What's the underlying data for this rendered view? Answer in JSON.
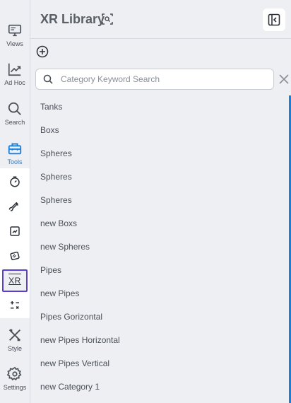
{
  "nav": {
    "items": [
      {
        "label": "Views",
        "icon": "monitor-icon"
      },
      {
        "label": "Ad Hoc",
        "icon": "chart-line-icon"
      },
      {
        "label": "Search",
        "icon": "search-icon"
      },
      {
        "label": "Tools",
        "icon": "toolbox-icon",
        "active": true
      },
      {
        "label": "Style",
        "icon": "pencil-ruler-icon"
      },
      {
        "label": "Settings",
        "icon": "gear-icon"
      }
    ],
    "tools": [
      {
        "icon": "gauge-icon"
      },
      {
        "icon": "paint-brush-icon"
      },
      {
        "icon": "chart-card-icon"
      },
      {
        "icon": "stack-icon"
      },
      {
        "icon": "xr-icon",
        "text": "XR",
        "selected": true
      },
      {
        "icon": "calculator-icon"
      }
    ]
  },
  "header": {
    "title": "XR Library"
  },
  "search": {
    "placeholder": "Category Keyword Search",
    "value": ""
  },
  "categories": [
    "Tanks",
    "Boxs",
    "Spheres",
    "Spheres",
    "Spheres",
    "new Boxs",
    "new Spheres",
    "Pipes",
    "new Pipes",
    "Pipes Gorizontal",
    "new Pipes Horizontal",
    "new Pipes Vertical",
    "new Category 1"
  ],
  "colors": {
    "accent": "#1a7fd6",
    "selected_outline": "#5a3fd0",
    "background": "#edeff3"
  }
}
